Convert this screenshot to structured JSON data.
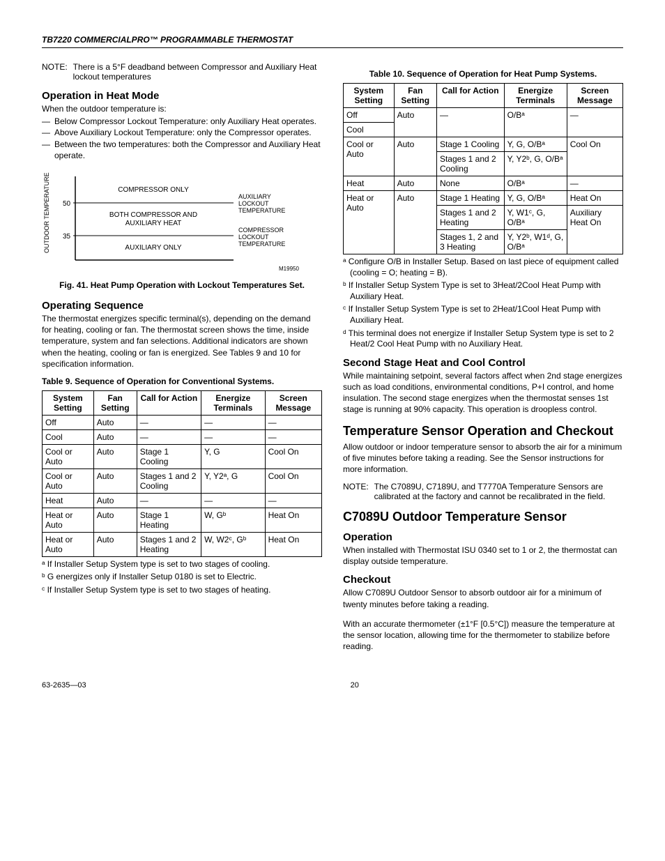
{
  "header": "TB7220 COMMERCIALPRO™ PROGRAMMABLE THERMOSTAT",
  "left": {
    "note1_label": "NOTE:",
    "note1_text": "There is a 5°F deadband between Compressor and Auxiliary Heat lockout temperatures",
    "h_op_heat": "Operation in Heat Mode",
    "op_heat_intro": "When the outdoor temperature is:",
    "op_heat_items": [
      "Below Compressor Lockout Temperature: only Auxiliary Heat operates.",
      "Above Auxiliary Lockout Temperature: only the Compressor operates.",
      "Between the two temperatures: both the Compressor and Auxiliary Heat operate."
    ],
    "fig41": "Fig. 41. Heat Pump Operation with Lockout Temperatures Set.",
    "h_op_seq": "Operating Sequence",
    "op_seq_p": "The thermostat energizes specific terminal(s), depending on the demand for heating, cooling or fan. The thermostat screen shows the time, inside temperature, system and fan selections. Additional indicators are shown when the heating, cooling or fan is energized. See Tables 9 and 10 for specification information.",
    "t9_caption": "Table 9. Sequence of Operation for Conventional Systems.",
    "t9_headers": [
      "System Setting",
      "Fan Setting",
      "Call for Action",
      "Energize Terminals",
      "Screen Message"
    ],
    "t9_rows": [
      {
        "sys": "Off",
        "fan": "Auto",
        "call": "—",
        "en": "—",
        "msg": "—"
      },
      {
        "sys": "Cool",
        "fan": "Auto",
        "call": "—",
        "en": "—",
        "msg": "—"
      },
      {
        "sys": "Cool or Auto",
        "fan": "Auto",
        "call": "Stage 1 Cooling",
        "en": "Y, G",
        "msg": "Cool On"
      },
      {
        "sys": "Cool or Auto",
        "fan": "Auto",
        "call": "Stages 1 and 2 Cooling",
        "en": "Y, Y2ᵃ, G",
        "msg": "Cool On"
      },
      {
        "sys": "Heat",
        "fan": "Auto",
        "call": "—",
        "en": "—",
        "msg": "—"
      },
      {
        "sys": "Heat or Auto",
        "fan": "Auto",
        "call": "Stage 1 Heating",
        "en": "W, Gᵇ",
        "msg": "Heat On"
      },
      {
        "sys": "Heat or Auto",
        "fan": "Auto",
        "call": "Stages 1 and 2 Heating",
        "en": "W, W2ᶜ, Gᵇ",
        "msg": "Heat On"
      }
    ],
    "t9_foot_a": "ᵃ If Installer Setup System type is set to two stages of cooling.",
    "t9_foot_b": "ᵇ G energizes only if Installer Setup 0180 is set to Electric.",
    "t9_foot_c": "ᶜ If Installer Setup System type is set to two stages of heating."
  },
  "right": {
    "t10_caption": "Table 10. Sequence of Operation for Heat Pump Systems.",
    "t10_headers": [
      "System Setting",
      "Fan Setting",
      "Call for Action",
      "Energize Terminals",
      "Screen Message"
    ],
    "t10_foot_a": "ᵃ Configure O/B in Installer Setup. Based on last piece of equipment called (cooling = O; heating = B).",
    "t10_foot_b": "ᵇ If Installer Setup System Type is set to 3Heat/2Cool Heat Pump with Auxiliary Heat.",
    "t10_foot_c": "ᶜ If Installer Setup System Type is set to 2Heat/1Cool Heat Pump with Auxiliary Heat.",
    "t10_foot_d": "ᵈ This terminal does not energize if Installer Setup System type is set to 2 Heat/2 Cool Heat Pump with no Auxiliary Heat.",
    "h_second_stage": "Second Stage Heat and Cool Control",
    "second_stage_p": "While maintaining setpoint, several factors affect when 2nd stage energizes such as load conditions, environmental conditions, P+I control, and home insulation. The second stage energizes when the thermostat senses 1st stage is running at 90% capacity. This operation is droopless control.",
    "h_temp_sensor": "Temperature Sensor Operation and Checkout",
    "temp_sensor_p": "Allow outdoor or indoor temperature sensor to absorb the air for a minimum of five minutes before taking a reading. See the Sensor instructions for more information.",
    "note2_label": "NOTE:",
    "note2_text": "The C7089U, C7189U, and T7770A Temperature Sensors are calibrated at the factory and cannot be recalibrated in the field.",
    "h_c7089u": "C7089U Outdoor Temperature Sensor",
    "h_operation": "Operation",
    "operation_p": "When installed with Thermostat ISU 0340 set to 1 or 2, the thermostat can display outside temperature.",
    "h_checkout": "Checkout",
    "checkout_p1": "Allow C7089U Outdoor Sensor to absorb outdoor air for a minimum of twenty minutes before taking a reading.",
    "checkout_p2": "With an accurate thermometer (±1°F [0.5°C]) measure the temperature at the sensor location, allowing time for the thermometer to stabilize before reading."
  },
  "diagram": {
    "ylabel": "OUTDOOR  TEMPERATURE",
    "tick50": "50",
    "tick35": "35",
    "zone_top": "COMPRESSOR ONLY",
    "zone_mid1": "BOTH COMPRESSOR AND",
    "zone_mid2": "AUXILIARY HEAT",
    "zone_bot": "AUXILIARY ONLY",
    "lbl_aux1": "AUXILIARY",
    "lbl_aux2": "LOCKOUT",
    "lbl_aux3": "TEMPERATURE",
    "lbl_comp1": "COMPRESSOR",
    "lbl_comp2": "LOCKOUT",
    "lbl_comp3": "TEMPERATURE",
    "code": "M19950"
  },
  "t10_cells": {
    "r1_sys": "Off",
    "r1_fan": "Auto",
    "r1_call": "—",
    "r1_en": "O/Bᵃ",
    "r1_msg": "—",
    "r2_sys": "Cool",
    "r3_sys": "Cool or Auto",
    "r3_fan": "Auto",
    "r3_call": "Stage 1 Cooling",
    "r3_en": "Y, G, O/Bᵃ",
    "r3_msg": "Cool On",
    "r4_call": "Stages 1 and 2 Cooling",
    "r4_en": "Y, Y2ᵇ, G, O/Bᵃ",
    "r5_sys": "Heat",
    "r5_fan": "Auto",
    "r5_call": "None",
    "r5_en": "O/Bᵃ",
    "r5_msg": "—",
    "r6_sys": "Heat or Auto",
    "r6_fan": "Auto",
    "r6_call": "Stage 1 Heating",
    "r6_en": "Y, G, O/Bᵃ",
    "r6_msg": "Heat On",
    "r7_call": "Stages 1 and 2 Heating",
    "r7_en": "Y, W1ᶜ, G, O/Bᵃ",
    "r7_msg": "Auxiliary Heat On",
    "r8_call": "Stages 1, 2 and 3 Heating",
    "r8_en": "Y, Y2ᵇ, W1ᵈ, G, O/Bᵃ"
  },
  "footer": {
    "docnum": "63-2635—03",
    "pagenum": "20"
  },
  "chart_data": {
    "type": "area",
    "title": "Heat Pump Operation with Lockout Temperatures Set",
    "ylabel": "Outdoor Temperature",
    "thresholds": [
      {
        "name": "Auxiliary Lockout Temperature",
        "value": 50
      },
      {
        "name": "Compressor Lockout Temperature",
        "value": 35
      }
    ],
    "zones": [
      {
        "range": ">50",
        "label": "COMPRESSOR ONLY"
      },
      {
        "range": "35-50",
        "label": "BOTH COMPRESSOR AND AUXILIARY HEAT"
      },
      {
        "range": "<35",
        "label": "AUXILIARY ONLY"
      }
    ]
  }
}
